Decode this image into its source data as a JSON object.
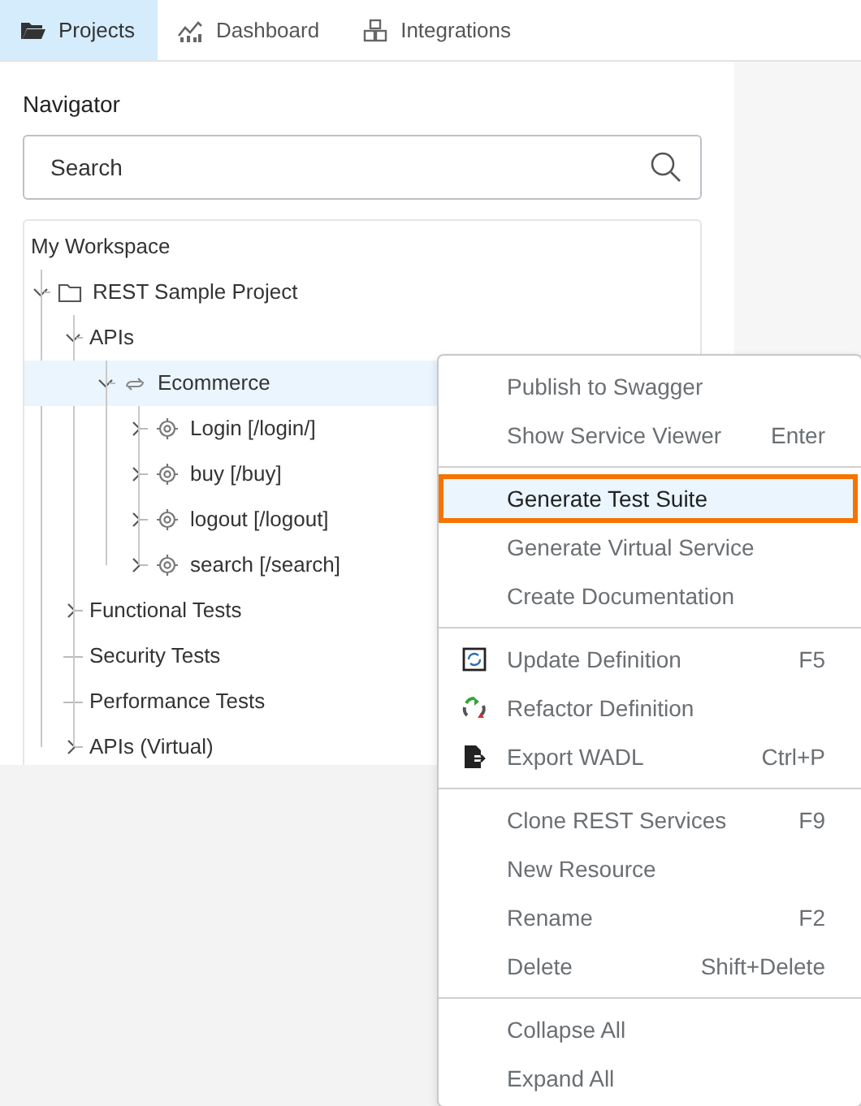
{
  "tabs": [
    {
      "label": "Projects",
      "kind": "folder",
      "selected": true
    },
    {
      "label": "Dashboard",
      "kind": "chart",
      "selected": false
    },
    {
      "label": "Integrations",
      "kind": "cubes",
      "selected": false
    }
  ],
  "navigator": {
    "title": "Navigator",
    "search": {
      "placeholder": "Search"
    },
    "tree": [
      {
        "label": "My Workspace",
        "children": [
          {
            "label": "REST Sample Project",
            "kind": "folder",
            "expanded": true,
            "selected": false,
            "children": [
              {
                "label": "APIs",
                "expanded": true,
                "selected": false,
                "children": [
                  {
                    "label": "Ecommerce",
                    "kind": "service",
                    "expanded": true,
                    "selected": true,
                    "children": [
                      {
                        "label": "Login [/login/]",
                        "kind": "resource",
                        "expanded": false,
                        "selected": false
                      },
                      {
                        "label": "buy [/buy]",
                        "kind": "resource",
                        "expanded": false,
                        "selected": false
                      },
                      {
                        "label": "logout [/logout]",
                        "kind": "resource",
                        "expanded": false,
                        "selected": false
                      },
                      {
                        "label": "search [/search]",
                        "kind": "resource",
                        "expanded": false,
                        "selected": false
                      }
                    ]
                  }
                ]
              },
              {
                "label": "Functional Tests",
                "expanded": false,
                "selected": false
              },
              {
                "label": "Security Tests",
                "selected": false
              },
              {
                "label": "Performance Tests",
                "selected": false
              },
              {
                "label": "APIs (Virtual)",
                "expanded": false,
                "selected": false
              }
            ]
          }
        ]
      }
    ]
  },
  "context_menu": {
    "sections": [
      [
        {
          "label": "Publish to Swagger",
          "selected": false
        },
        {
          "label": "Show Service Viewer",
          "shortcut": "Enter",
          "selected": false
        }
      ],
      [
        {
          "label": "Generate Test Suite",
          "selected": true
        },
        {
          "label": "Generate Virtual Service",
          "selected": false
        },
        {
          "label": "Create Documentation",
          "selected": false
        }
      ],
      [
        {
          "label": "Update Definition",
          "shortcut": "F5",
          "kind": "update",
          "selected": false
        },
        {
          "label": "Refactor Definition",
          "kind": "refactor",
          "selected": false
        },
        {
          "label": "Export WADL",
          "shortcut": "Ctrl+P",
          "kind": "export",
          "selected": false
        }
      ],
      [
        {
          "label": "Clone REST Services",
          "shortcut": "F9",
          "selected": false
        },
        {
          "label": "New Resource",
          "selected": false
        },
        {
          "label": "Rename",
          "shortcut": "F2",
          "selected": false
        },
        {
          "label": "Delete",
          "shortcut": "Shift+Delete",
          "selected": false
        }
      ],
      [
        {
          "label": "Collapse All",
          "selected": false
        },
        {
          "label": "Expand All",
          "selected": false
        }
      ]
    ]
  }
}
